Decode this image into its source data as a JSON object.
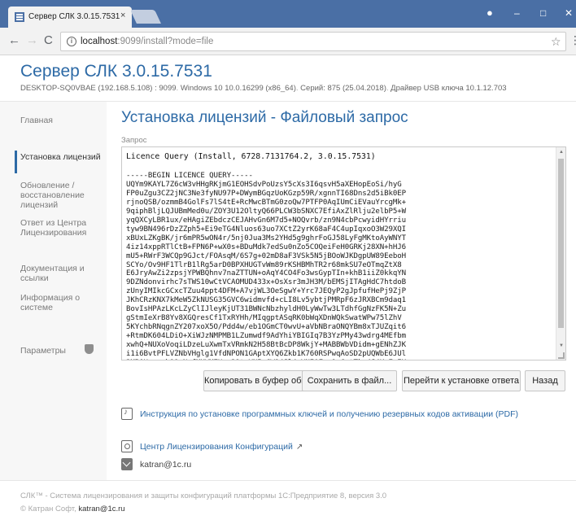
{
  "browser": {
    "tab_title": "Сервер СЛК 3.0.15.7531",
    "tab_close": "×",
    "url_host": "localhost",
    "url_rest": ":9099/install?mode=file",
    "icons": {
      "back": "arrow-left-icon",
      "forward": "arrow-right-icon",
      "reload": "reload-icon",
      "info": "info-icon",
      "star": "star-icon",
      "menu": "kebab-menu-icon",
      "user": "profile-icon"
    },
    "controls": {
      "back": "←",
      "forward": "→",
      "reload": "C",
      "info": "i",
      "star": "☆",
      "menu": "⋮",
      "user": "●",
      "minimize": "–",
      "maximize": "□",
      "close": "✕"
    }
  },
  "app": {
    "title": "Сервер СЛК 3.0.15.7531",
    "host": "DESKTOP-SQ0VBAE (192.168.5.108) : 9099",
    "os": "Windows 10 10.0.16299 (x86_64)",
    "series": "Серий: 875 (25.04.2018)",
    "driver": "Драйвер USB ключа 10.1.12.703",
    "separator": "."
  },
  "sidebar": {
    "items": [
      {
        "label": "Главная"
      },
      {
        "label": "Установка лицензий"
      },
      {
        "label": "Обновление / восстановление лицензий"
      },
      {
        "label": "Ответ из Центра Лицензирования"
      },
      {
        "label": "Документация и ссылки"
      },
      {
        "label": "Информация о системе"
      },
      {
        "label": "Параметры"
      }
    ]
  },
  "main": {
    "heading": "Установка лицензий - Файловый запрос",
    "field_label": "Запрос",
    "request_first_line": "Licence Query (Install, 6728.7131764.2, 3.0.15.7531)",
    "request_body": "-----BEGIN LICENCE QUERY-----\nUQYm9KAYL7Z6cW3vHHgRKjmG1EOHSdvPoUzsY5cXs3I6qsvH5aXEHopEoSi/hyG\nFP0uZgu3CZ2jNC3Ne3fyNU97P+DWymBGqzUoKGzp59R/xgnnTI68Dns2d5iBk0EP\nrjnoQSB/ozmmB4GolFs7lS4tE+RcMwcBTmG0zoQw7PTFP0AqIUmCiEVauYrcgMk+\n9qiphBljLQJUBmMed0u/ZOY3U12OltyQ66PLCW3bSNXC7EfiAxZlRlju2elbP5+W\nyqQXCyLBR1ux/eHAgiZEbdczCEJAHvGn6M7d5+NOQvrb/zn9N4cbPcwyidHYrriu\ntyw9BN496rDzZZph5+Ei9eTG4Nluos63uo7XCtZ2yrK68aF4C4upIqxoO3W29XQI\nxBUxLZKgBK/jr6mPR5wON4r/5nj0Jua3Ms2YHd5g9ghrFoGJ58LyFgMKtoAyWNYT\n4iz14xppRTlCtB+FPN6P+wX0s+BDuMdk7edSu0nZo5COQeiFeH0GRKj28XN+hHJ6\nmU5+RWrF3WCQp9GJct/FOAsqM/6S7g+02mD8aF3VSk5N5jBOoWJKDgpUW89EeboH\nSCYo/Ov9HF1TlrB1lRg5arD0BPXHUGTvWm89rKSHBMhTR2r68mkSU7eOTmqZtX8\nE6JryAwZi2zpsjYPWBQhnv7naZTTUN+oAqY4CO4Fo3wsGypTIn+khB1iiZ0kkqYN\n9DZNdonvirhc7sTWS10wCtVCAOMUD433x+OsXsr3mJH3M/bEMSjITAgHdC7htdoB\nzUnyIMIkcGCxcTZuu4ppt4DFM+A7vjWL3OeSgwY+Yrc7JEQyP2gJpfufHePj9ZjP\nJKhCRzKNX7kMeW5ZkNUSG35GVC6widmvfd+cLI8Lv5ybtjPMRpF6zJRXBCm9daq1\nBovIsHPAzLKcLZyClIJleyKjUT31BWNcNbzhyldH0LyWwTw3LTdhfGgNzFK5N+Zu\ngStmIeXrB8Yv8XGQresCf1TxRYHh/MIqgptASqRK0bWqXDnWQkSwatWPw75lZhV\n5KYchbRNqgnZY207xoX5O/Pdd4w/eb1OGmCT0wvU+aVbNBraONQYBm8xTJUZqit6\n+RtmDK604LDiO+XiWJzNMPMB1LZumwdf9AdYhiYBIGIq7B3YzPMy43wdrg4MEfbm\nxwhQ+NUXoVoqiLDzeLuXwmTxVRmkN2H58BtBcDP8WkjY+MABBWbVDidm+gENhZJK\ni1i6BvtPFLVZNbVHglg1VfdNPON1GAptXYQ6Zkb1K760RSPwqAoSD2pUQWbE6JUl\n3MBiHex+zh11aNpfMUWMEHpm29tsVN5mGW14Jl4cVNIQFoa1wCqtTkv4J4KzEgIX",
    "buttons": {
      "copy": "Копировать в буфер обмена",
      "save": "Сохранить в файл...",
      "goto": "Перейти к установке ответа",
      "back": "Назад"
    },
    "links": {
      "pdf": "Инструкция по установке программных ключей и получению резервных кодов активации (PDF)",
      "center": "Центр Лицензирования Конфигураций",
      "external_mark": "↗",
      "email": "katran@1c.ru"
    },
    "scroll": {
      "up": "▲",
      "down": "▼"
    }
  },
  "footer": {
    "line1": "СЛК™ - Система лицензирования и защиты конфигураций платформы 1С:Предприятие 8, версия 3.0",
    "line2_prefix": "© Катран Софт, ",
    "line2_email": "katran@1c.ru"
  },
  "colors": {
    "accent": "#2d6aa6",
    "chrome_titlebar": "#4a6fa5"
  }
}
